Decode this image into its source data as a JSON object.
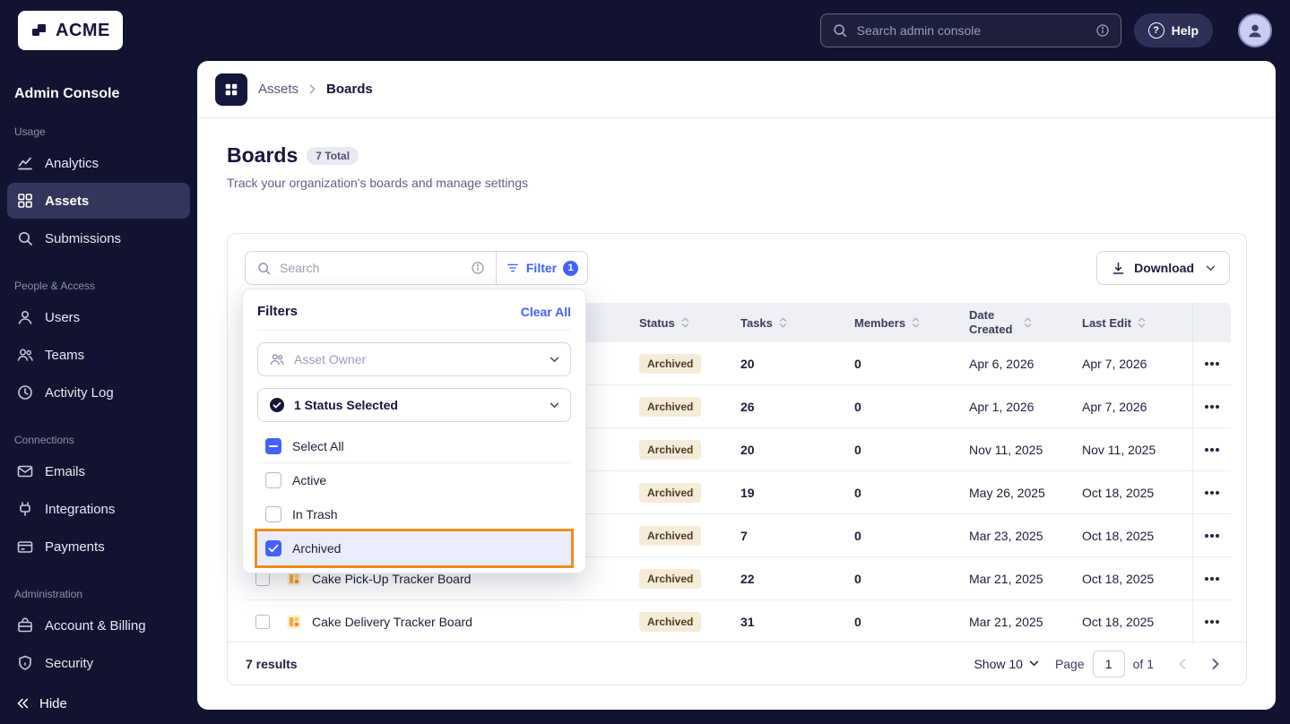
{
  "colors": {
    "accent_blue": "#4262ff",
    "sidebar_bg": "#111331",
    "highlight_orange": "#f08c1e",
    "status_badge_bg": "#f6ebd9",
    "status_badge_text": "#4b3d20"
  },
  "icons": [
    "search-icon",
    "info-icon",
    "filter-icon",
    "download-icon",
    "chevron-down-icon",
    "sort-icon",
    "more-icon",
    "board-icon",
    "help-icon",
    "avatar-icon",
    "grid-icon",
    "analytics-icon",
    "assets-icon",
    "submissions-icon",
    "users-icon",
    "teams-icon",
    "activity-log-icon",
    "emails-icon",
    "integrations-icon",
    "payments-icon",
    "billing-icon",
    "security-icon",
    "hide-icon",
    "people-icon",
    "status-check-icon",
    "check-icon",
    "chevron-left-icon",
    "chevron-right-icon"
  ],
  "topbar": {
    "logo_text": "ACME",
    "search_placeholder": "Search admin console",
    "help_icon": "?",
    "help_label": "Help"
  },
  "sidebar": {
    "title": "Admin Console",
    "sections": [
      {
        "label": "Usage",
        "items": [
          {
            "label": "Analytics"
          },
          {
            "label": "Assets"
          },
          {
            "label": "Submissions"
          }
        ]
      },
      {
        "label": "People & Access",
        "items": [
          {
            "label": "Users"
          },
          {
            "label": "Teams"
          },
          {
            "label": "Activity Log"
          }
        ]
      },
      {
        "label": "Connections",
        "items": [
          {
            "label": "Emails"
          },
          {
            "label": "Integrations"
          },
          {
            "label": "Payments"
          }
        ]
      },
      {
        "label": "Administration",
        "items": [
          {
            "label": "Account & Billing"
          },
          {
            "label": "Security"
          }
        ]
      }
    ],
    "hide_label": "Hide"
  },
  "breadcrumb": {
    "parent": "Assets",
    "current": "Boards"
  },
  "page": {
    "title": "Boards",
    "total_badge": "7 Total",
    "subtitle": "Track your organization's boards and manage settings"
  },
  "toolbar": {
    "search_placeholder": "Search",
    "filter_label": "Filter",
    "filter_count": "1",
    "download_label": "Download"
  },
  "filters_panel": {
    "title": "Filters",
    "clear_all_label": "Clear All",
    "owner_placeholder": "Asset Owner",
    "status_value": "1 Status Selected",
    "options": [
      {
        "label": "Select All",
        "state": "indeterminate"
      },
      {
        "label": "Active",
        "state": "unchecked"
      },
      {
        "label": "In Trash",
        "state": "unchecked"
      },
      {
        "label": "Archived",
        "state": "checked",
        "highlighted": true
      }
    ]
  },
  "table": {
    "columns": {
      "status": "Status",
      "tasks": "Tasks",
      "members": "Members",
      "date_created": "Date Created",
      "last_edit": "Last Edit"
    },
    "rows": [
      {
        "name": "",
        "status": "Archived",
        "tasks": "20",
        "members": "0",
        "date_created": "Apr 6, 2026",
        "last_edit": "Apr 7, 2026"
      },
      {
        "name": "",
        "status": "Archived",
        "tasks": "26",
        "members": "0",
        "date_created": "Apr 1, 2026",
        "last_edit": "Apr 7, 2026"
      },
      {
        "name": "",
        "status": "Archived",
        "tasks": "20",
        "members": "0",
        "date_created": "Nov 11, 2025",
        "last_edit": "Nov 11, 2025"
      },
      {
        "name": "",
        "status": "Archived",
        "tasks": "19",
        "members": "0",
        "date_created": "May 26, 2025",
        "last_edit": "Oct 18, 2025"
      },
      {
        "name": "",
        "status": "Archived",
        "tasks": "7",
        "members": "0",
        "date_created": "Mar 23, 2025",
        "last_edit": "Oct 18, 2025"
      },
      {
        "name": "Cake Pick-Up Tracker Board",
        "status": "Archived",
        "tasks": "22",
        "members": "0",
        "date_created": "Mar 21, 2025",
        "last_edit": "Oct 18, 2025"
      },
      {
        "name": "Cake Delivery Tracker Board",
        "status": "Archived",
        "tasks": "31",
        "members": "0",
        "date_created": "Mar 21, 2025",
        "last_edit": "Oct 18, 2025"
      }
    ],
    "footer": {
      "results": "7 results",
      "show_label": "Show 10",
      "page_label": "Page",
      "page_value": "1",
      "of_label": "of 1"
    }
  }
}
